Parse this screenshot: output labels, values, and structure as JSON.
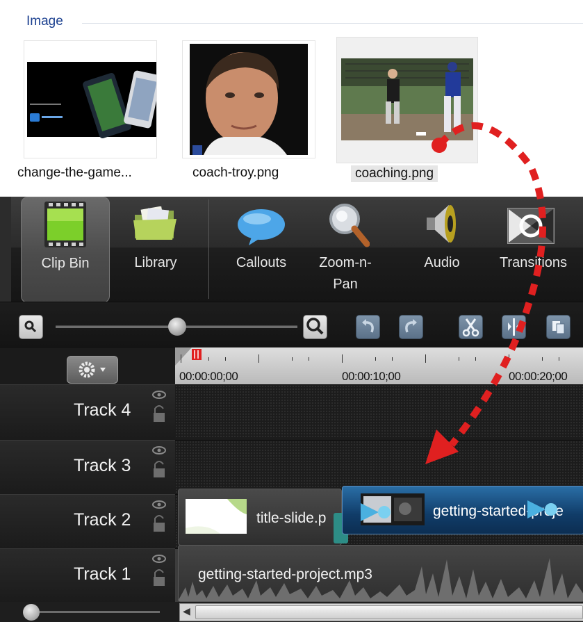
{
  "image_bin": {
    "group_label": "Image",
    "items": [
      {
        "caption": "change-the-game...",
        "selected": false
      },
      {
        "caption": "coach-troy.png",
        "selected": false
      },
      {
        "caption": "coaching.png",
        "selected": true
      }
    ]
  },
  "tabs": [
    {
      "label": "Clip Bin",
      "icon": "film-icon",
      "active": true
    },
    {
      "label": "Library",
      "icon": "folder-icon",
      "active": false
    },
    {
      "label": "Callouts",
      "icon": "speech-bubble-icon",
      "active": false
    },
    {
      "label": "Zoom-n-\nPan",
      "icon": "magnifier-icon",
      "active": false
    },
    {
      "label": "Audio",
      "icon": "speaker-icon",
      "active": false
    },
    {
      "label": "Transitions",
      "icon": "transition-icon",
      "active": false
    }
  ],
  "ruler": {
    "labels": [
      "00:00:00;00",
      "00:00:10;00",
      "00:00:20;00"
    ]
  },
  "tracks": [
    {
      "name": "Track 4"
    },
    {
      "name": "Track 3"
    },
    {
      "name": "Track 2"
    },
    {
      "name": "Track 1"
    }
  ],
  "clips": {
    "title_slide": "title-slide.p",
    "getting_started": "getting-started-proje",
    "audio": "getting-started-project.mp3"
  },
  "annotation_color": "#e02020"
}
